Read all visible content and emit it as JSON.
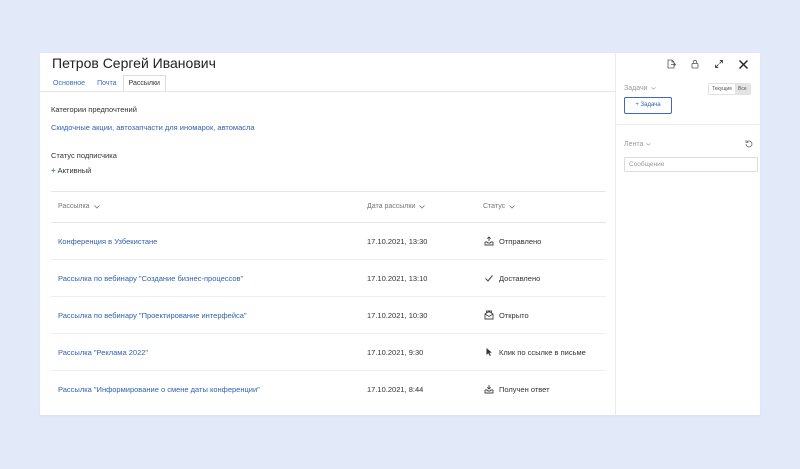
{
  "contact": {
    "name": "Петров Сергей Иванович"
  },
  "tabs": [
    {
      "label": "Основное",
      "active": false
    },
    {
      "label": "Почта",
      "active": false
    },
    {
      "label": "Рассылки",
      "active": true
    }
  ],
  "preferences": {
    "heading": "Категории предпочтений",
    "value": "Скидочные акции, автозапчасти для иномарок, автомасла"
  },
  "subscriber_status": {
    "heading": "Статус подписчика",
    "value": "Активный"
  },
  "table": {
    "columns": [
      "Рассылка",
      "Дата рассылки",
      "Статус"
    ],
    "rows": [
      {
        "name": "Конференция в Узбекистане",
        "date": "17.10.2021, 13:30",
        "status": "Отправлено",
        "icon": "inbox-send-icon"
      },
      {
        "name": "Рассылка по вебинару \"Создание бизнес-процессов\"",
        "date": "17.10.2021, 13:10",
        "status": "Доставлено",
        "icon": "check-icon"
      },
      {
        "name": "Рассылка по вебинару \"Проектирование интерфейса\"",
        "date": "17.10.2021, 10:30",
        "status": "Открыто",
        "icon": "open-mail-icon"
      },
      {
        "name": "Рассылка \"Реклама 2022\"",
        "date": "17.10.2021, 9:30",
        "status": "Клик по ссылке в письме",
        "icon": "cursor-icon"
      },
      {
        "name": "Рассылка \"Информирование о смене даты конференции\"",
        "date": "17.10.2021, 8:44",
        "status": "Получен ответ",
        "icon": "inbox-reply-icon"
      }
    ]
  },
  "side": {
    "tasks_label": "Задачи",
    "toggle_current": "Текущие",
    "toggle_all": "Все",
    "add_task_label": "+ Задача",
    "feed_label": "Лента",
    "message_placeholder": "Сообщение"
  },
  "colors": {
    "accent": "#2f62b0",
    "status_active": "#3aaa55",
    "background": "#e2e9f9"
  }
}
